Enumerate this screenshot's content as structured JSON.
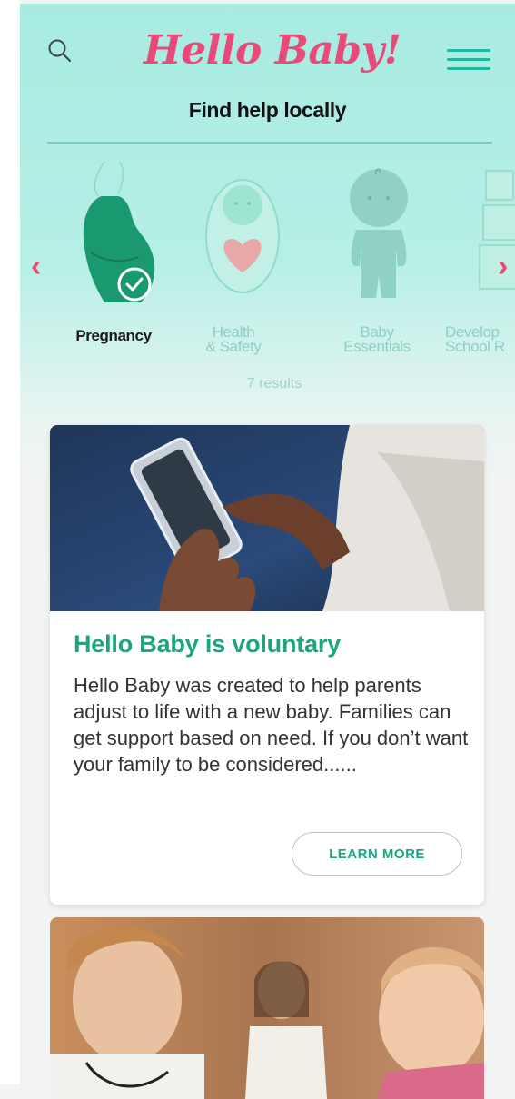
{
  "header": {
    "logo_text": "Hello Baby!",
    "subtitle": "Find help locally",
    "search_icon": "search-icon",
    "menu_icon": "hamburger-menu-icon"
  },
  "categories": {
    "items": [
      {
        "label": "Pregnancy",
        "selected": true,
        "icon": "pregnant-woman-icon"
      },
      {
        "label": "Health\n& Safety",
        "selected": false,
        "icon": "swaddled-baby-heart-icon"
      },
      {
        "label": "Baby\nEssentials",
        "selected": false,
        "icon": "baby-onesie-icon"
      },
      {
        "label": "Develop\nSchool R",
        "selected": false,
        "icon": "building-blocks-icon"
      }
    ],
    "results_text": "7 results",
    "prev_icon": "chevron-left-icon",
    "next_icon": "chevron-right-icon"
  },
  "cards": [
    {
      "title": "Hello Baby is voluntary",
      "body": "Hello Baby was created to help parents adjust to life with a new baby. Families can get support based on need. If you don’t want your family to be considered......",
      "button": "LEARN MORE",
      "image": "hands-holding-smartphone-photo"
    },
    {
      "image": "doctor-with-stethoscope-and-baby-photo"
    }
  ],
  "colors": {
    "brand_pink": "#e94a7a",
    "accent_teal": "#1aa681",
    "header_bg": "#a8ece1"
  }
}
